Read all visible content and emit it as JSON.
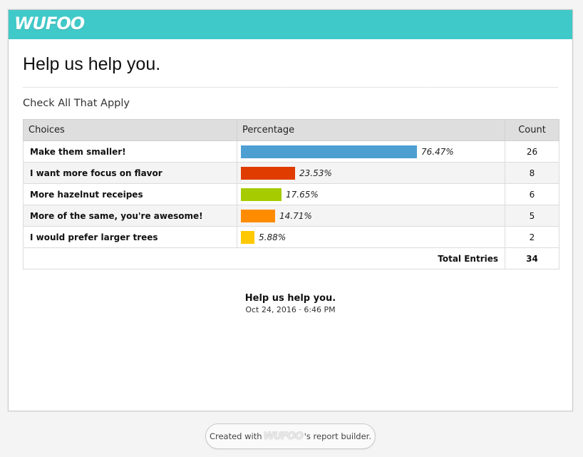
{
  "brand": {
    "logo_text": "WUFOO",
    "bar_color": "#40c9c9"
  },
  "report": {
    "title": "Help us help you.",
    "section_title": "Check All That Apply"
  },
  "table": {
    "headers": {
      "choices": "Choices",
      "percentage": "Percentage",
      "count": "Count"
    },
    "rows": [
      {
        "choice": "Make them smaller!",
        "percent": 76.47,
        "percent_label": "76.47%",
        "count": "26",
        "color": "#4d9fd2"
      },
      {
        "choice": "I want more focus on flavor",
        "percent": 23.53,
        "percent_label": "23.53%",
        "count": "8",
        "color": "#e03c00"
      },
      {
        "choice": "More hazelnut receipes",
        "percent": 17.65,
        "percent_label": "17.65%",
        "count": "6",
        "color": "#a6cc00"
      },
      {
        "choice": "More of the same, you're awesome!",
        "percent": 14.71,
        "percent_label": "14.71%",
        "count": "5",
        "color": "#ff8c00"
      },
      {
        "choice": "I would prefer larger trees",
        "percent": 5.88,
        "percent_label": "5.88%",
        "count": "2",
        "color": "#ffc800"
      }
    ],
    "total_label": "Total Entries",
    "total_count": "34"
  },
  "footer": {
    "title": "Help us help you.",
    "date": "Oct 24, 2016 · 6:46 PM"
  },
  "credit": {
    "prefix": "Created with",
    "logo_text": "WUFOO",
    "suffix": "'s report builder."
  }
}
